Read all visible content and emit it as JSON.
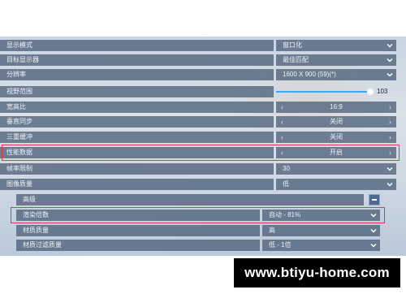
{
  "settings": {
    "display_mode": {
      "label": "显示模式",
      "value": "窗口化"
    },
    "target_display": {
      "label": "目标显示器",
      "value": "最佳匹配"
    },
    "resolution": {
      "label": "分辨率",
      "value": "1600 X 900 (59)(*)"
    },
    "fov": {
      "label": "视野范围",
      "value": "103",
      "level_fraction": 1.0
    },
    "aspect_ratio": {
      "label": "宽高比",
      "value": "16:9"
    },
    "vsync": {
      "label": "垂直同步",
      "value": "关闭"
    },
    "triple_buffer": {
      "label": "三重缓冲",
      "value": "关闭"
    },
    "perf_data": {
      "label": "性能数据",
      "value": "开启"
    },
    "fps_limit": {
      "label": "帧率限制",
      "value": "30"
    },
    "graphics_quality": {
      "label": "图像质量",
      "value": "低"
    },
    "advanced": {
      "label": "高级"
    },
    "render_scale": {
      "label": "渲染倍数",
      "value": "自动 - 81%"
    },
    "texture_quality": {
      "label": "材质质量",
      "value": "高"
    },
    "texture_filtering": {
      "label": "材质过滤质量",
      "value": "低 - 1倍"
    }
  },
  "watermark": {
    "text": "www.btiyu-home.com"
  },
  "colors": {
    "highlight": "#e03a3a",
    "accent": "#3aa9ff",
    "row_bg": "#4e627a"
  }
}
